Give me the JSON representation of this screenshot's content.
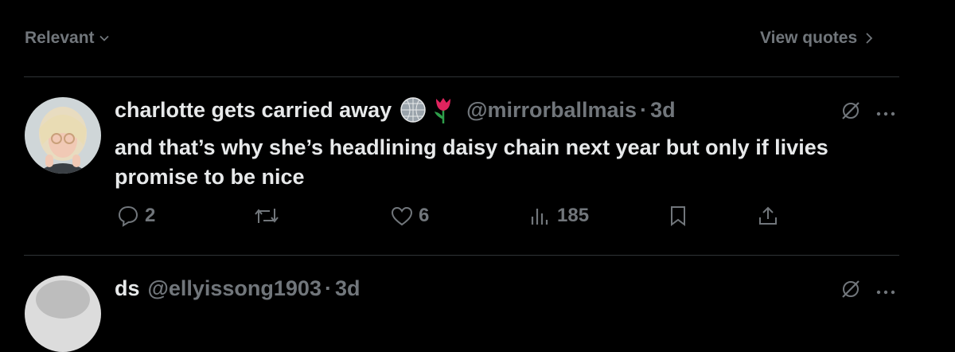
{
  "filter": {
    "label": "Relevant",
    "chevron": "chevron-down-icon"
  },
  "view_quotes": {
    "label": "View quotes",
    "chevron": "chevron-right-icon"
  },
  "tweet": {
    "display_name": "charlotte gets carried away",
    "emojis": [
      "disco-ball-icon",
      "tulip-icon"
    ],
    "handle": "@mirrorballmais",
    "separator": "·",
    "time": "3d",
    "text": "and that’s why she’s headlining daisy chain next year but only if livies promise to be nice",
    "replies": "2",
    "likes": "6",
    "views": "185"
  },
  "next_tweet": {
    "display_name": "ds",
    "handle": "@ellyissong1903",
    "separator": "·",
    "time": "3d"
  },
  "colors": {
    "background": "#000000",
    "text": "#e7e9ea",
    "muted": "#71767b",
    "divider": "#2f3336"
  }
}
